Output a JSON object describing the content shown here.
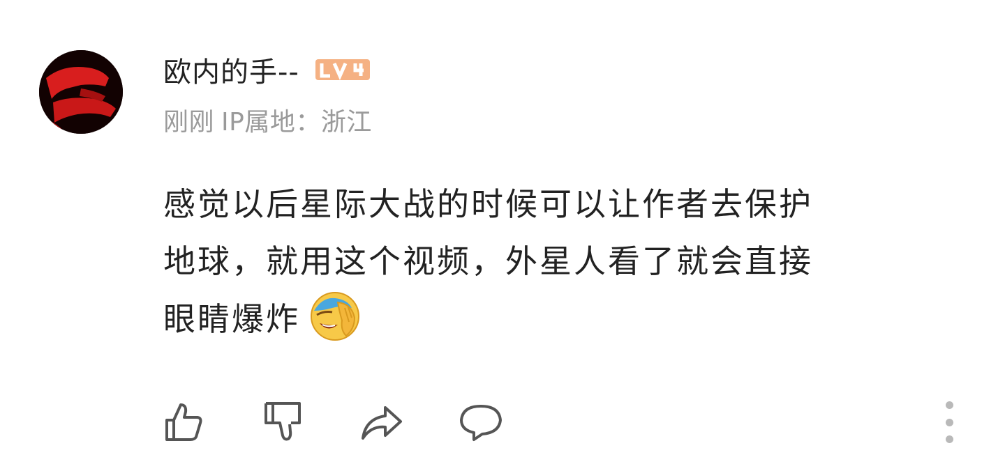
{
  "comment": {
    "username": "欧内的手--",
    "level_badge": "LV4",
    "time": "刚刚",
    "ip_location": "IP属地：浙江",
    "content_lines": [
      "感觉以后星际大战的时候可以让作者去保护",
      "地球，就用这个视频，外星人看了就会直接",
      "眼睛爆炸"
    ],
    "emoji": "facepalm-laughing-emoji"
  },
  "actions": [
    {
      "icon": "thumbs-up-icon"
    },
    {
      "icon": "thumbs-down-icon"
    },
    {
      "icon": "share-icon"
    },
    {
      "icon": "reply-icon"
    },
    {
      "icon": "more-vertical-icon"
    }
  ],
  "colors": {
    "username": "#222222",
    "meta": "#9a9a9a",
    "badge": "#f5b183",
    "icon_stroke": "#555555",
    "more_dots": "#b9b9b9",
    "avatar_red": "#d81e1e"
  }
}
